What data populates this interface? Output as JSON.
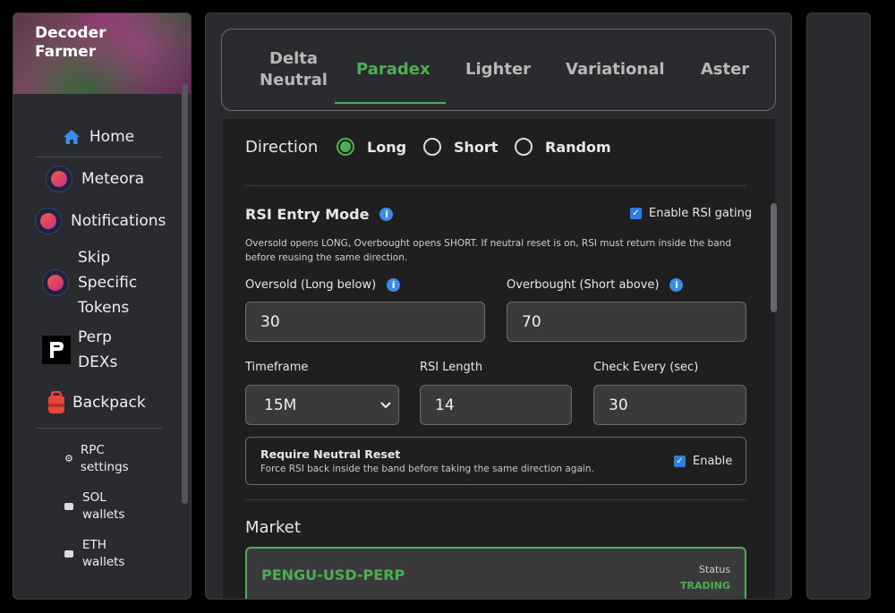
{
  "sidebar": {
    "brand_title": "Decoder Farmer",
    "home": "Home",
    "meteora": "Meteora",
    "notifications": "Notifications",
    "skip_specific_tokens": "Skip Specific Tokens",
    "perp_dexs": "Perp DEXs",
    "backpack": "Backpack",
    "rpc_settings": "RPC settings",
    "sol_wallets": "SOL wallets",
    "eth_wallets": "ETH wallets"
  },
  "tabs": [
    "Delta Neutral",
    "Paradex",
    "Lighter",
    "Variational",
    "Aster"
  ],
  "active_tab": "Paradex",
  "direction": {
    "label": "Direction",
    "options": [
      "Long",
      "Short",
      "Random"
    ],
    "selected": "Long"
  },
  "rsi": {
    "title": "RSI Entry Mode",
    "enable_gating_label": "Enable RSI gating",
    "enable_gating_checked": true,
    "description": "Oversold opens LONG, Overbought opens SHORT. If neutral reset is on, RSI must return inside the band before reusing the same direction.",
    "oversold_label": "Oversold (Long below)",
    "oversold_value": "30",
    "overbought_label": "Overbought (Short above)",
    "overbought_value": "70",
    "timeframe_label": "Timeframe",
    "timeframe_value": "15M",
    "length_label": "RSI Length",
    "length_value": "14",
    "check_every_label": "Check Every (sec)",
    "check_every_value": "30",
    "neutral_reset_title": "Require Neutral Reset",
    "neutral_reset_desc": "Force RSI back inside the band before taking the same direction again.",
    "neutral_reset_enable_label": "Enable",
    "neutral_reset_checked": true
  },
  "market": {
    "label": "Market",
    "symbol": "PENGU-USD-PERP",
    "status_label": "Status",
    "status_value": "TRADING"
  },
  "colors": {
    "accent_green": "#4caf50",
    "info_blue": "#3d8be8",
    "checkbox_blue": "#2f7de1",
    "home_icon_blue": "#3d8be8",
    "backpack_red": "#e8453c"
  }
}
